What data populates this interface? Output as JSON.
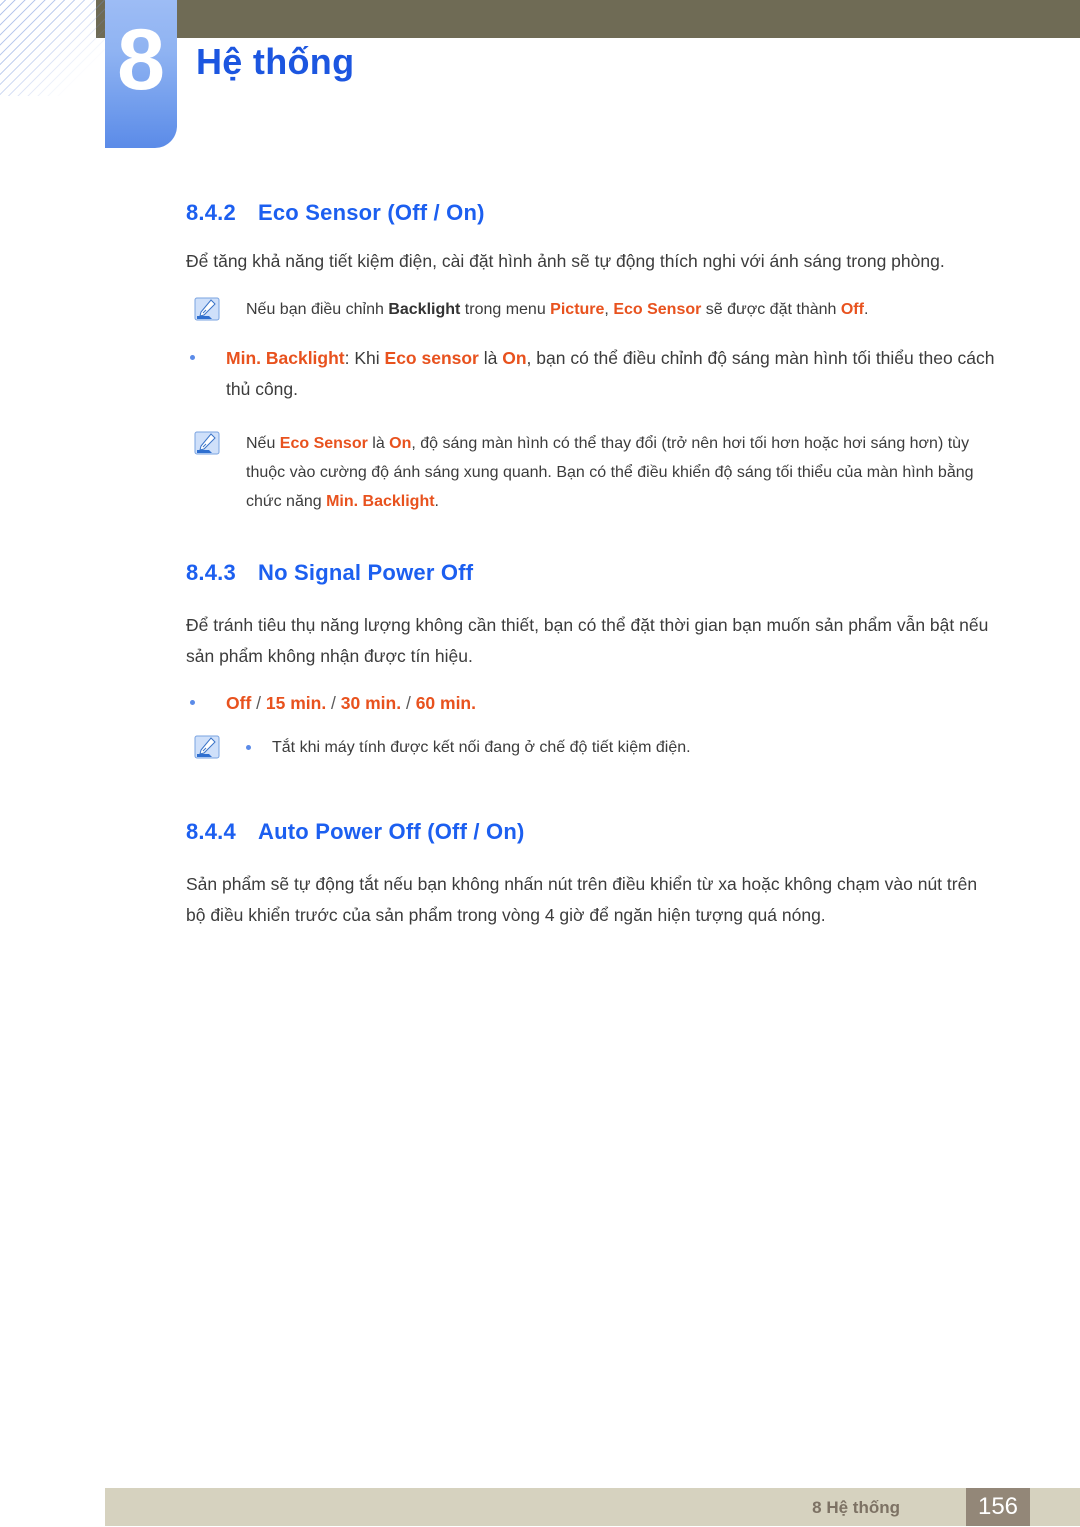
{
  "header": {
    "chapter_number": "8",
    "chapter_title": "Hệ thống",
    "olive_bar_color": "#6f6b55",
    "badge_color": "#6f9bec",
    "title_color": "#1c56e0"
  },
  "sections": [
    {
      "number": "8.4.2",
      "title": "Eco Sensor (Off / On)",
      "paragraph": "Để tăng khả năng tiết kiệm điện, cài đặt hình ảnh sẽ tự động thích nghi với ánh sáng trong phòng.",
      "note1": {
        "icon": "note-pencil-icon",
        "t1": "Nếu bạn điều chỉnh ",
        "k1": "Backlight",
        "t2": " trong menu ",
        "k2": "Picture",
        "t3": ", ",
        "k3": "Eco Sensor",
        "t4": " sẽ được đặt thành ",
        "k4": "Off",
        "t5": "."
      },
      "bullet": {
        "k1": "Min. Backlight",
        "t1": ": Khi ",
        "k2": "Eco sensor",
        "t2": " là ",
        "k3": "On",
        "t3": ", bạn có thể điều chỉnh độ sáng màn hình tối thiểu theo cách thủ công."
      },
      "note2": {
        "icon": "note-pencil-icon",
        "t1": "Nếu ",
        "k1": "Eco Sensor",
        "t2": " là ",
        "k2": "On",
        "t3": ", độ sáng màn hình có thể thay đổi (trở nên hơi tối hơn hoặc hơi sáng hơn) tùy thuộc vào cường độ ánh sáng xung quanh. Bạn có thể điều khiển độ sáng tối thiểu của màn hình bằng chức năng ",
        "k3": "Min. Backlight",
        "t4": "."
      }
    },
    {
      "number": "8.4.3",
      "title": "No Signal Power Off",
      "paragraph": "Để tránh tiêu thụ năng lượng không cần thiết, bạn có thể đặt thời gian bạn muốn sản phẩm vẫn bật nếu sản phẩm không nhận được tín hiệu.",
      "options_bullet": {
        "o1": "Off",
        "s1": " / ",
        "o2": "15 min.",
        "s2": " / ",
        "o3": "30 min.",
        "s3": " / ",
        "o4": "60 min."
      },
      "note": {
        "icon": "note-pencil-icon",
        "text": "Tắt khi máy tính được kết nối đang ở chế độ tiết kiệm điện."
      }
    },
    {
      "number": "8.4.4",
      "title": "Auto Power Off (Off / On)",
      "paragraph": "Sản phẩm sẽ tự động tắt nếu bạn không nhấn nút trên điều khiển từ xa hoặc không chạm vào nút trên bộ điều khiển trước của sản phẩm trong vòng 4 giờ để ngăn hiện tượng quá nóng."
    }
  ],
  "footer": {
    "label": "8 Hệ thống",
    "page_number": "156",
    "bar_color": "#d6d2bf",
    "page_box_color": "#938778"
  }
}
